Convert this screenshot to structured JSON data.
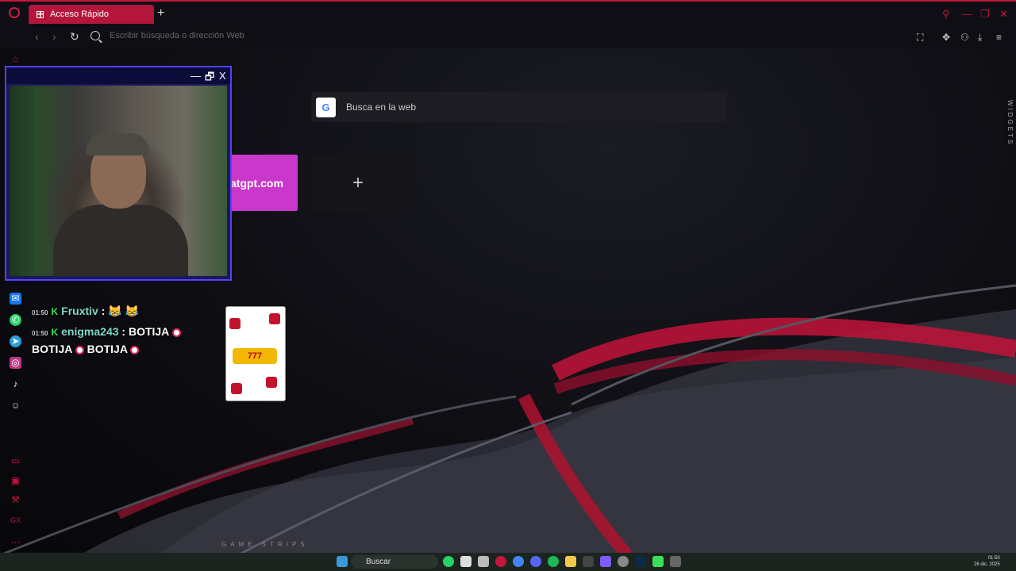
{
  "browser": {
    "tab_label": "Acceso Rápido",
    "address_placeholder": "Escribir búsqueda o dirección Web"
  },
  "speed_dial": {
    "search_placeholder": "Busca en la web",
    "google_letter": "G",
    "tile_label": "atgpt.com",
    "add_label": "+",
    "widgets_label": "WIDGETS"
  },
  "cam": {
    "minimize": "—",
    "restore": "🗗",
    "close": "X"
  },
  "chat": {
    "messages": [
      {
        "time": "01:50",
        "user": "Fruxtiv",
        "text": ":"
      },
      {
        "time": "01:50",
        "user": "enigma243",
        "text": ": BOTIJA"
      }
    ],
    "continuation": "BOTIJA",
    "continuation2": "BOTIJA"
  },
  "overlay": {
    "slot_reels": "777",
    "game_strips": "GAME STRIPS"
  },
  "taskbar": {
    "search_label": "Buscar",
    "time": "01:50",
    "date": "26 dic. 2025"
  },
  "colors": {
    "accent": "#c4163c",
    "tile_purple": "#c938cb",
    "cam_border": "#5540ff"
  }
}
